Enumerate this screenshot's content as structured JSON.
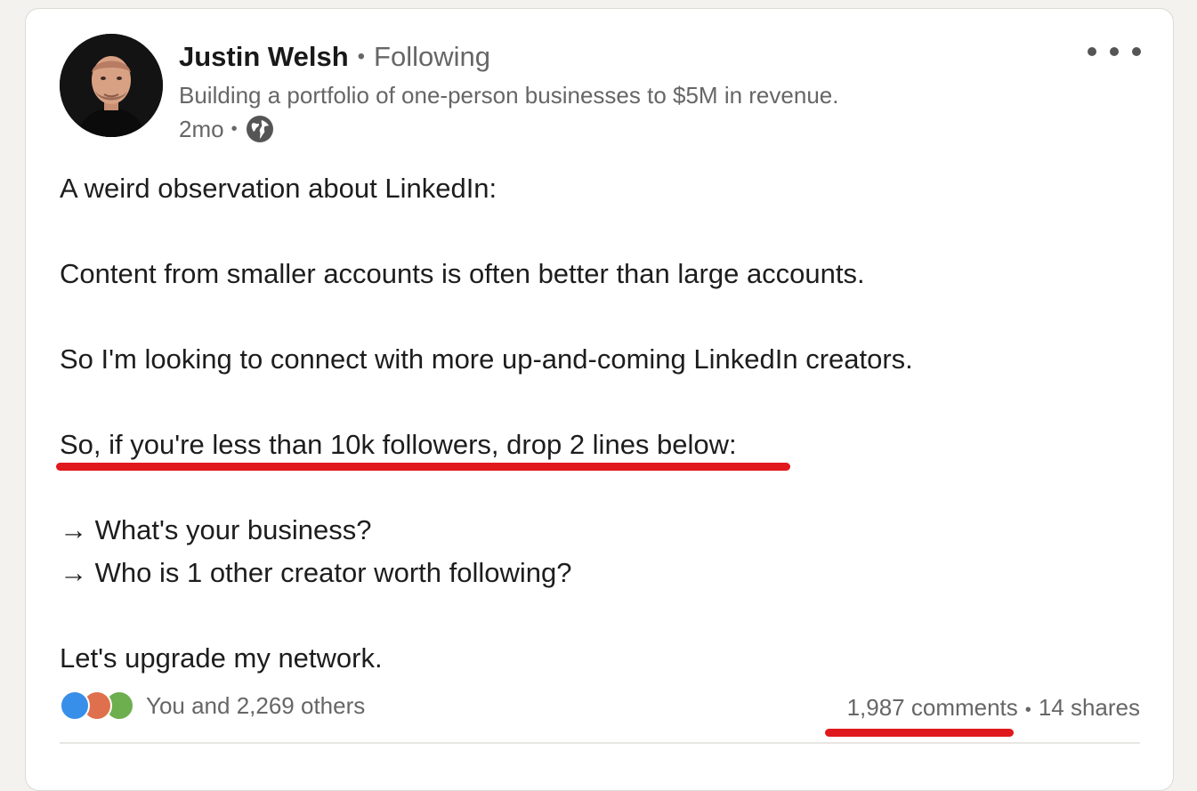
{
  "author": {
    "name": "Justin Welsh",
    "follow_status": "Following",
    "headline": "Building a portfolio of one-person businesses to $5M in revenue.",
    "post_age": "2mo",
    "visibility_icon": "globe-icon"
  },
  "post": {
    "lines": [
      "A weird observation about LinkedIn:",
      "Content from smaller accounts is often better than large accounts.",
      "So I'm looking to connect with more up-and-coming LinkedIn creators.",
      "So, if you're less than 10k followers, drop 2 lines below:",
      "→ What's your business?",
      "→ Who is 1 other creator worth following?",
      "Let's upgrade my network."
    ]
  },
  "social": {
    "reaction_icons": [
      "like-icon",
      "love-icon",
      "support-icon"
    ],
    "reactions_text": "You and 2,269 others",
    "comments_text": "1,987 comments",
    "shares_text": "14 shares"
  },
  "colors": {
    "highlight_underline": "#e0191d",
    "like": "#378fe9",
    "love": "#df704d",
    "support": "#6dae4f",
    "secondary_text": "#666666"
  }
}
